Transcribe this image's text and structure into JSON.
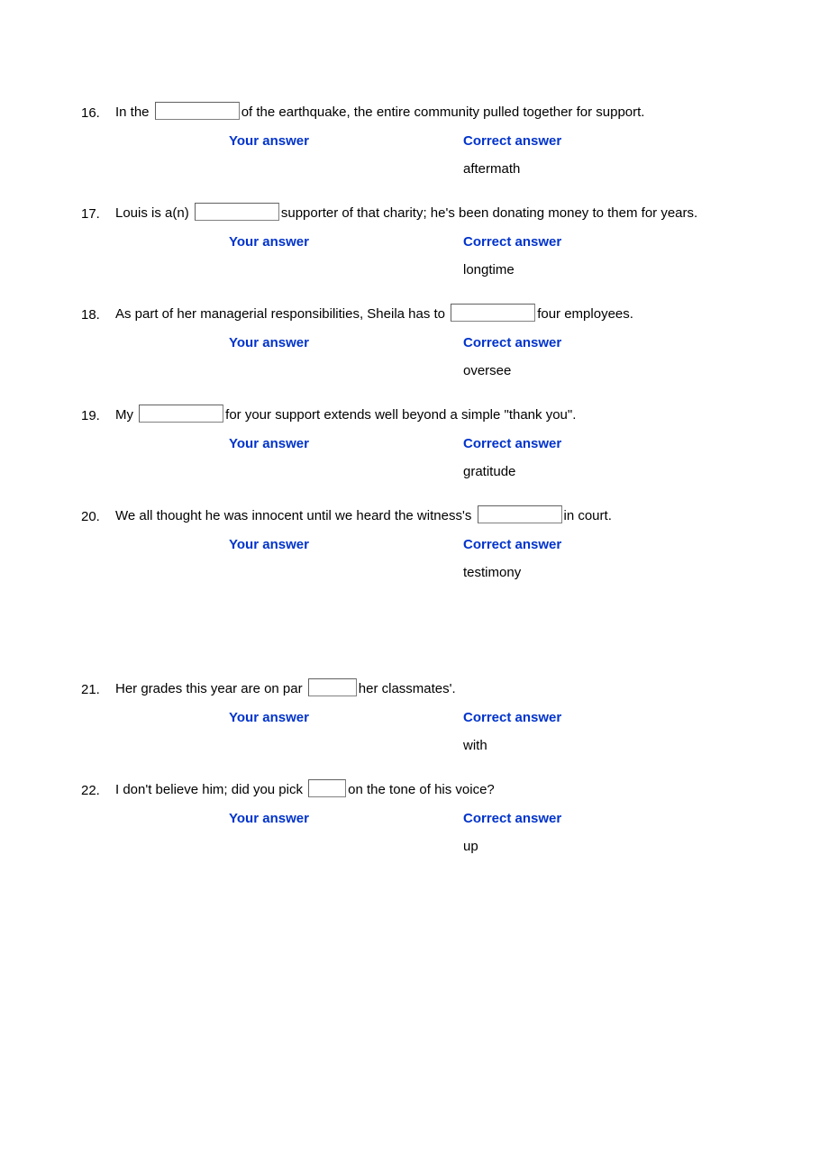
{
  "labels": {
    "your_answer": "Your answer",
    "correct_answer": "Correct answer"
  },
  "questions": [
    {
      "number": "16.",
      "pre": "In the ",
      "post": "of the earthquake, the entire community pulled together for support.",
      "blank_class": "blank-wide",
      "correct": "aftermath"
    },
    {
      "number": "17.",
      "pre": "Louis is a(n) ",
      "post": "supporter of that charity; he's been donating money to them for years.",
      "blank_class": "blank-wide",
      "correct": "longtime"
    },
    {
      "number": "18.",
      "pre": "As part of her managerial responsibilities, Sheila has to ",
      "post": "four employees.",
      "blank_class": "blank-med",
      "correct": "oversee"
    },
    {
      "number": "19.",
      "pre": "My ",
      "post": "for your support extends well beyond a simple \"thank you\".",
      "blank_class": "blank-wide",
      "correct": "gratitude"
    },
    {
      "number": "20.",
      "pre": "We all thought he was innocent until we heard the witness's ",
      "post": "in court.",
      "blank_class": "blank-med",
      "correct": "testimony"
    },
    {
      "number": "21.",
      "pre": "Her grades this year are on par ",
      "post": "her classmates'.",
      "blank_class": "blank-small",
      "correct": "with"
    },
    {
      "number": "22.",
      "pre": "I don't believe him; did you pick ",
      "post": "on the tone of his voice?",
      "blank_class": "blank-xsmall",
      "correct": "up"
    }
  ]
}
